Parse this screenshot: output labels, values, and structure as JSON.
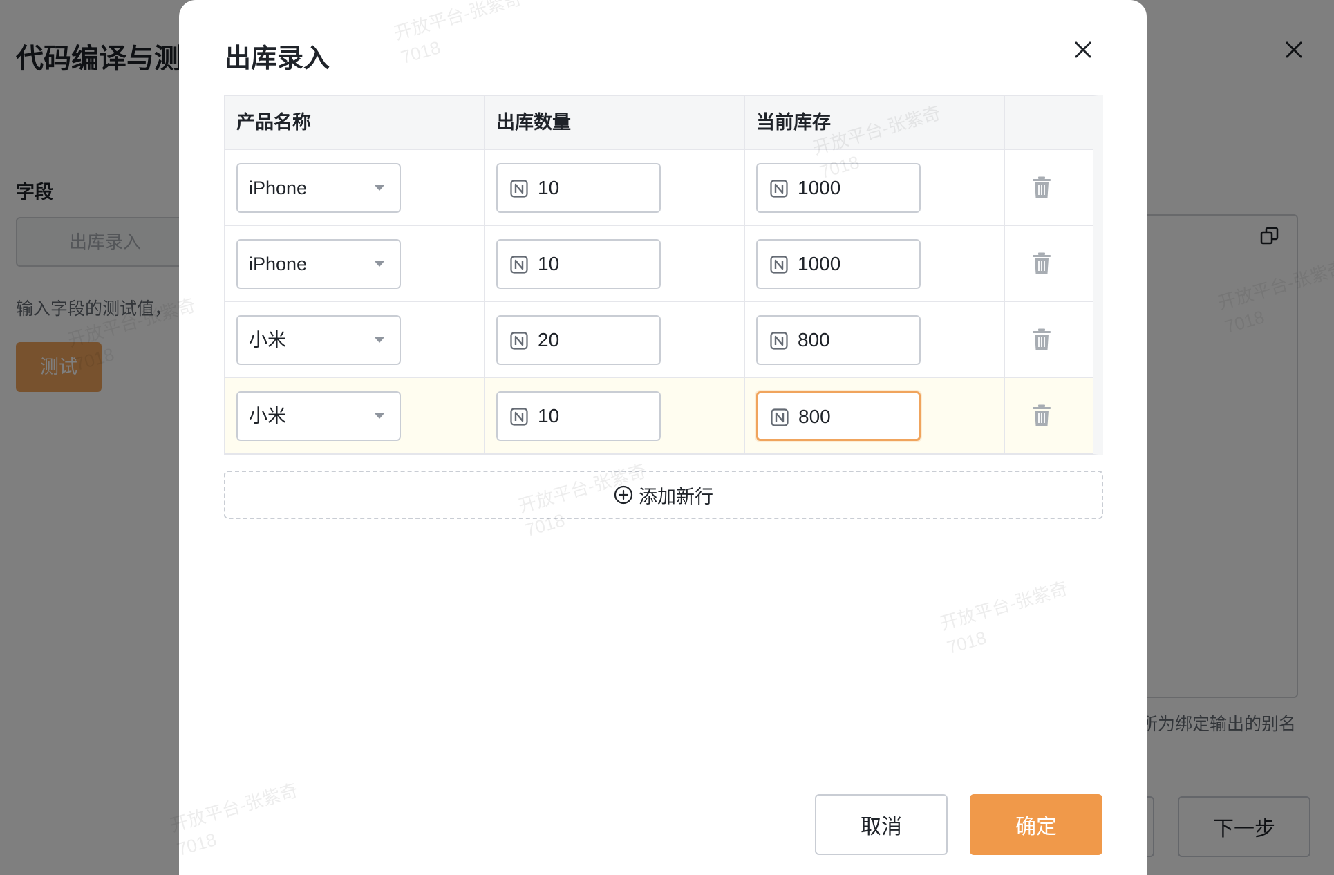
{
  "background": {
    "title": "代码编译与测",
    "field_label": "字段",
    "field_input_value": "出库录入",
    "hint": "输入字段的测试值，",
    "test_button": "测试",
    "alias_hint": "所为绑定输出的别名",
    "next_button": "下一步"
  },
  "modal": {
    "title": "出库录入",
    "columns": [
      "产品名称",
      "出库数量",
      "当前库存"
    ],
    "rows": [
      {
        "product": "iPhone",
        "quantity": "10",
        "stock": "1000"
      },
      {
        "product": "iPhone",
        "quantity": "10",
        "stock": "1000"
      },
      {
        "product": "小米",
        "quantity": "20",
        "stock": "800"
      },
      {
        "product": "小米",
        "quantity": "10",
        "stock": "800"
      }
    ],
    "add_row_label": "添加新行",
    "cancel_label": "取消",
    "ok_label": "确定"
  },
  "watermark": {
    "line1": "开放平台-张紫奇",
    "line2": "7018"
  },
  "colors": {
    "accent": "#f0994a",
    "focus_border": "#f0a45d",
    "highlight_row": "#fffdf0",
    "mask": "rgba(0,0,0,0.5)"
  }
}
